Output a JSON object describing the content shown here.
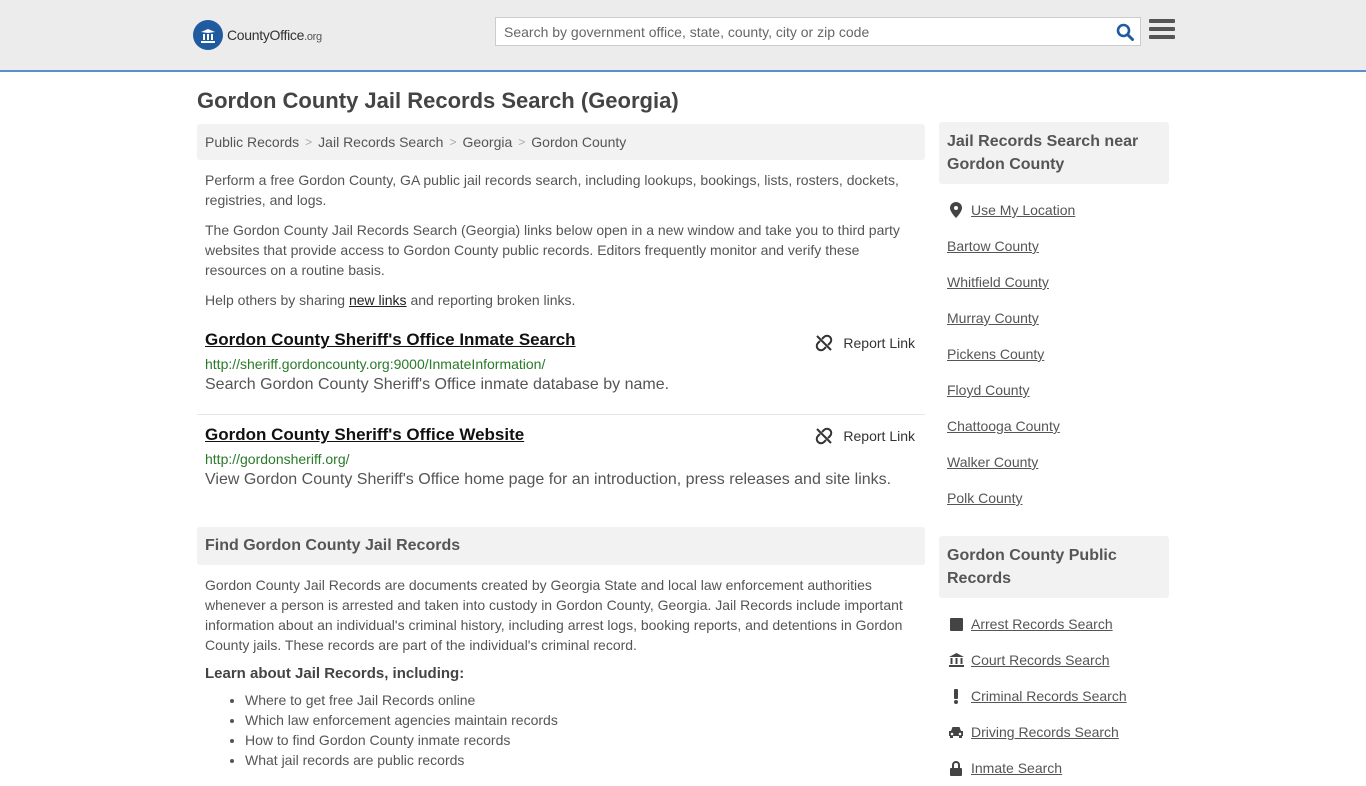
{
  "header": {
    "logo_text": "CountyOffice",
    "logo_suffix": ".org",
    "search_placeholder": "Search by government office, state, county, city or zip code"
  },
  "page_title": "Gordon County Jail Records Search (Georgia)",
  "breadcrumb": [
    "Public Records",
    "Jail Records Search",
    "Georgia",
    "Gordon County"
  ],
  "intro": {
    "p1": "Perform a free Gordon County, GA public jail records search, including lookups, bookings, lists, rosters, dockets, registries, and logs.",
    "p2": "The Gordon County Jail Records Search (Georgia) links below open in a new window and take you to third party websites that provide access to Gordon County public records. Editors frequently monitor and verify these resources on a routine basis.",
    "p3_before": "Help others by sharing ",
    "p3_link": "new links",
    "p3_after": " and reporting broken links."
  },
  "links": [
    {
      "title": "Gordon County Sheriff's Office Inmate Search",
      "url": "http://sheriff.gordoncounty.org:9000/InmateInformation/",
      "desc": "Search Gordon County Sheriff's Office inmate database by name.",
      "report": "Report Link"
    },
    {
      "title": "Gordon County Sheriff's Office Website",
      "url": "http://gordonsheriff.org/",
      "desc": "View Gordon County Sheriff's Office home page for an introduction, press releases and site links.",
      "report": "Report Link"
    }
  ],
  "find_section": {
    "heading": "Find Gordon County Jail Records",
    "body": "Gordon County Jail Records are documents created by Georgia State and local law enforcement authorities whenever a person is arrested and taken into custody in Gordon County, Georgia. Jail Records include important information about an individual's criminal history, including arrest logs, booking reports, and detentions in Gordon County jails. These records are part of the individual's criminal record.",
    "learn_heading": "Learn about Jail Records, including:",
    "bullets": [
      "Where to get free Jail Records online",
      "Which law enforcement agencies maintain records",
      "How to find Gordon County inmate records",
      "What jail records are public records"
    ]
  },
  "sidebar": {
    "near_heading": "Jail Records Search near Gordon County",
    "use_location": "Use My Location",
    "near_counties": [
      "Bartow County",
      "Whitfield County",
      "Murray County",
      "Pickens County",
      "Floyd County",
      "Chattooga County",
      "Walker County",
      "Polk County"
    ],
    "public_heading": "Gordon County Public Records",
    "public_links": [
      {
        "label": "Arrest Records Search",
        "icon": "square-icon"
      },
      {
        "label": "Court Records Search",
        "icon": "courthouse-icon"
      },
      {
        "label": "Criminal Records Search",
        "icon": "exclamation-icon"
      },
      {
        "label": "Driving Records Search",
        "icon": "car-icon"
      },
      {
        "label": "Inmate Search",
        "icon": "lock-icon"
      }
    ]
  }
}
